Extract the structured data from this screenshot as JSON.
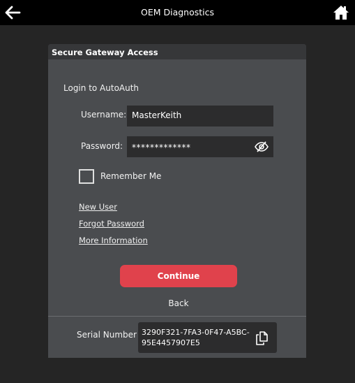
{
  "app": {
    "title": "OEM Diagnostics"
  },
  "dialog": {
    "header": "Secure Gateway Access",
    "heading": "Login to AutoAuth",
    "username_label": "Username:",
    "username_value": "MasterKeith",
    "password_label": "Password:",
    "password_value": "*************",
    "remember_label": "Remember Me",
    "remember_checked": false,
    "links": {
      "new_user": "New User",
      "forgot_password": "Forgot Password",
      "more_information": "More Information"
    },
    "continue_label": "Continue",
    "back_label": "Back",
    "serial_label": "Serial Number",
    "serial_value": "3290F321-7FA3-0F47-A5BC-95E4457907E5"
  },
  "icons": {
    "back": "arrow-left-icon",
    "home": "home-icon",
    "password_toggle": "eye-slash-icon",
    "copy": "copy-icon"
  },
  "colors": {
    "topbar": "#000000",
    "background": "#252525",
    "dialog": "#4a4c4f",
    "dialog_header": "#363739",
    "input": "#2c2c2d",
    "accent": "#e0424c"
  }
}
